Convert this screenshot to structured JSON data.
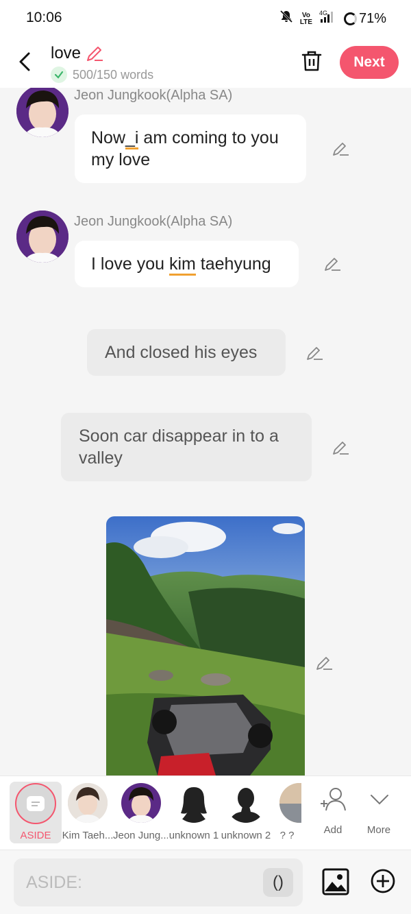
{
  "status": {
    "time": "10:06",
    "battery": "71%",
    "net": "4G",
    "volte_top": "Vo",
    "volte_bottom": "LTE"
  },
  "header": {
    "title": "love",
    "word_count": "500/150 words",
    "next_label": "Next"
  },
  "messages": [
    {
      "speaker": "Jeon Jungkook(Alpha SA)",
      "text_before": "Now",
      "text_highlight": "_i",
      "text_after": " am coming to you my love"
    },
    {
      "speaker": "Jeon Jungkook(Alpha SA)",
      "text_before": "I love you ",
      "text_highlight": "kim",
      "text_after": " taehyung"
    },
    {
      "aside": "And closed his eyes"
    },
    {
      "aside": "Soon car disappear in to a valley"
    }
  ],
  "characters": [
    {
      "label": "ASIDE",
      "selected": true
    },
    {
      "label": "Kim Taeh..."
    },
    {
      "label": "Jeon Jung..."
    },
    {
      "label": "unknown 1"
    },
    {
      "label": "unknown 2"
    },
    {
      "label": "? ?"
    },
    {
      "label": "Add"
    },
    {
      "label": "More"
    }
  ],
  "input": {
    "placeholder": "ASIDE:",
    "paren_label": "()"
  },
  "colors": {
    "accent": "#f4566e",
    "highlight": "#f0a030"
  }
}
